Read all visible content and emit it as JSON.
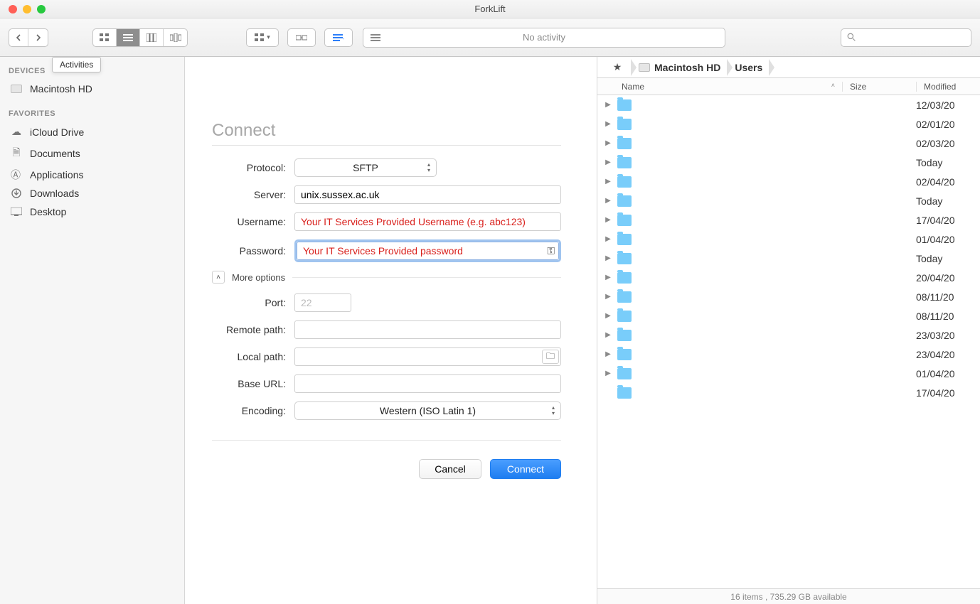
{
  "window": {
    "title": "ForkLift",
    "activity_label": "No activity"
  },
  "tooltip": "Activities",
  "sidebar": {
    "devices_heading": "DEVICES",
    "devices": [
      {
        "label": "Macintosh HD",
        "icon": "hd"
      }
    ],
    "favorites_heading": "FAVORITES",
    "favorites": [
      {
        "label": "iCloud Drive",
        "icon": "cloud"
      },
      {
        "label": "Documents",
        "icon": "doc"
      },
      {
        "label": "Applications",
        "icon": "apps"
      },
      {
        "label": "Downloads",
        "icon": "download"
      },
      {
        "label": "Desktop",
        "icon": "desktop"
      }
    ]
  },
  "connect": {
    "title": "Connect",
    "labels": {
      "protocol": "Protocol:",
      "server": "Server:",
      "username": "Username:",
      "password": "Password:",
      "more_options": "More options",
      "port": "Port:",
      "remote_path": "Remote path:",
      "local_path": "Local path:",
      "base_url": "Base URL:",
      "encoding": "Encoding:"
    },
    "values": {
      "protocol": "SFTP",
      "server": "unix.sussex.ac.uk",
      "username": "Your IT Services Provided Username (e.g. abc123)",
      "password": "Your IT Services Provided password",
      "port_placeholder": "22",
      "remote_path": "",
      "local_path": "",
      "base_url": "",
      "encoding": "Western (ISO Latin 1)"
    },
    "buttons": {
      "cancel": "Cancel",
      "connect": "Connect"
    }
  },
  "browse": {
    "path": {
      "disk": "Macintosh HD",
      "dir": "Users"
    },
    "columns": {
      "name": "Name",
      "size": "Size",
      "modified": "Modified"
    },
    "rows": [
      {
        "modified": "12/03/20",
        "expandable": true
      },
      {
        "modified": "02/01/20",
        "expandable": true
      },
      {
        "modified": "02/03/20",
        "expandable": true
      },
      {
        "modified": "Today",
        "expandable": true
      },
      {
        "modified": "02/04/20",
        "expandable": true
      },
      {
        "modified": "Today",
        "expandable": true
      },
      {
        "modified": "17/04/20",
        "expandable": true
      },
      {
        "modified": "01/04/20",
        "expandable": true
      },
      {
        "modified": "Today",
        "expandable": true
      },
      {
        "modified": "20/04/20",
        "expandable": true
      },
      {
        "modified": "08/11/20",
        "expandable": true
      },
      {
        "modified": "08/11/20",
        "expandable": true
      },
      {
        "modified": "23/03/20",
        "expandable": true
      },
      {
        "modified": "23/04/20",
        "expandable": true
      },
      {
        "modified": "01/04/20",
        "expandable": true
      },
      {
        "modified": "17/04/20",
        "expandable": false
      }
    ],
    "status": "16 items , 735.29 GB available"
  }
}
